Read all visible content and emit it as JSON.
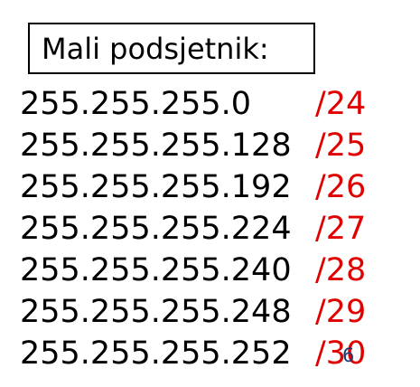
{
  "title": "Mali podsjetnik:",
  "masks": [
    {
      "ip": "255.255.255.0",
      "cidr": "/24"
    },
    {
      "ip": "255.255.255.128",
      "cidr": "/25"
    },
    {
      "ip": "255.255.255.192",
      "cidr": "/26"
    },
    {
      "ip": "255.255.255.224",
      "cidr": "/27"
    },
    {
      "ip": "255.255.255.240",
      "cidr": "/28"
    },
    {
      "ip": "255.255.255.248",
      "cidr": "/29"
    },
    {
      "ip": "255.255.255.252",
      "cidr": "/30"
    }
  ],
  "slide_number": "6",
  "colors": {
    "text": "#000000",
    "cidr": "#e00000",
    "slide_number": "#1f3b73"
  }
}
